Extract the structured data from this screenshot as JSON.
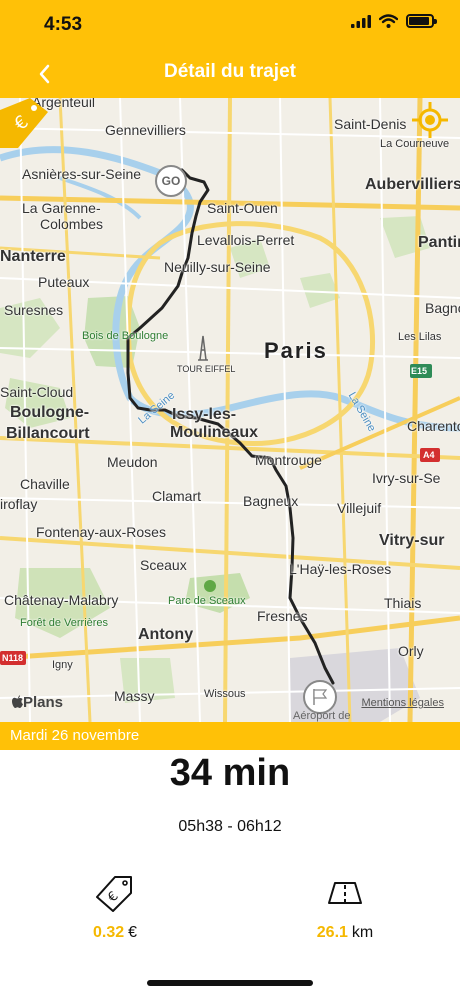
{
  "status": {
    "time": "4:53",
    "battery_level": 0.9
  },
  "nav": {
    "title": "Détail du trajet",
    "back_icon": "chevron-left-icon"
  },
  "map": {
    "labels": {
      "argenteuil": "Argenteuil",
      "gennevilliers": "Gennevilliers",
      "saint_denis": "Saint-Denis",
      "la_courneuve": "La Courneuve",
      "asnieres": "Asnières-sur-Seine",
      "aubervilliers": "Aubervilliers",
      "saint_ouen": "Saint-Ouen",
      "la_garenne": "La Garenne-",
      "colombes": "Colombes",
      "levallois": "Levallois-Perret",
      "pantin": "Pantin",
      "nanterre": "Nanterre",
      "neuilly": "Neuilly-sur-Seine",
      "puteaux": "Puteaux",
      "suresnes": "Suresnes",
      "bagnolet": "Bagnolet",
      "les_lilas": "Les Lilas",
      "bois_boulogne": "Bois de Boulogne",
      "paris": "Paris",
      "tour_eiffel": "TOUR EIFFEL",
      "saint_cloud": "Saint-Cloud",
      "seine1": "La Seine",
      "seine2": "La Seine",
      "boulogne": "Boulogne-",
      "billancourt": "Billancourt",
      "issy": "Issy-les-",
      "moulineaux": "Moulineaux",
      "charenton": "Charenton",
      "meudon": "Meudon",
      "montrouge": "Montrouge",
      "ivry": "Ivry-sur-Se",
      "chaville": "Chaville",
      "clamart": "Clamart",
      "bagneux": "Bagneux",
      "villejuif": "Villejuif",
      "viroflay": "iroflay",
      "fontenay": "Fontenay-aux-Roses",
      "vitry": "Vitry-sur",
      "sceaux": "Sceaux",
      "lhay": "L'Haÿ-les-Roses",
      "parc_sceaux": "Parc de Sceaux",
      "chatenay": "Châtenay-Malabry",
      "thiais": "Thiais",
      "foret": "Forêt de Verrières",
      "fresnes": "Fresnes",
      "antony": "Antony",
      "igny": "Igny",
      "orly": "Orly",
      "massy": "Massy",
      "wissous": "Wissous",
      "e15": "E15",
      "a4": "A4",
      "n118": "N118"
    },
    "go_marker": "GO",
    "attribution": "Plans",
    "legal": "Mentions légales",
    "airport": "Aéroport de"
  },
  "trip": {
    "date": "Mardi 26 novembre",
    "duration": "34 min",
    "time_range": "05h38 - 06h12",
    "cost_value": "0.32",
    "cost_unit": "€",
    "distance_value": "26.1",
    "distance_unit": "km"
  },
  "colors": {
    "accent": "#FFC107",
    "value": "#F5B800",
    "route": "#222222"
  }
}
